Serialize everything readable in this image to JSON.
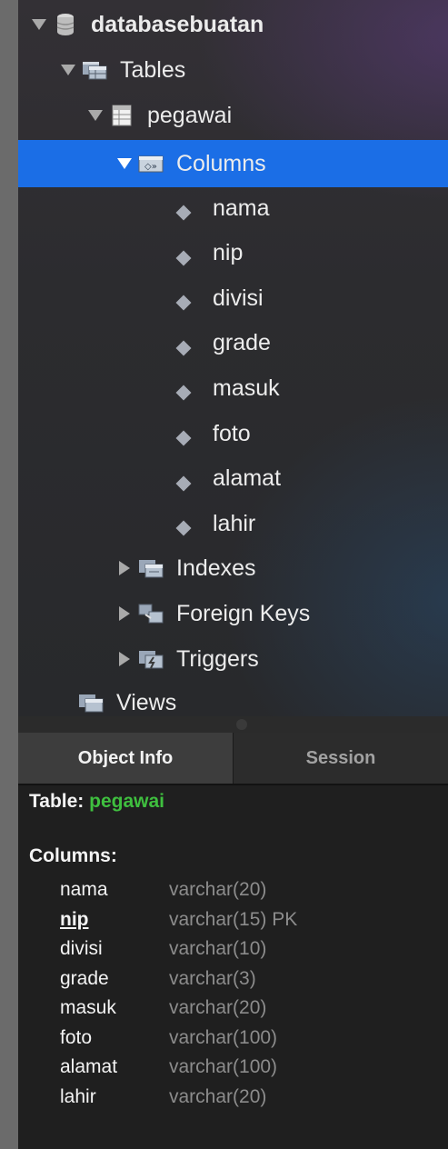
{
  "tree": {
    "database": "databasebuatan",
    "tables_label": "Tables",
    "table": "pegawai",
    "columns_label": "Columns",
    "columns": [
      "nama",
      "nip",
      "divisi",
      "grade",
      "masuk",
      "foto",
      "alamat",
      "lahir"
    ],
    "indexes_label": "Indexes",
    "foreign_keys_label": "Foreign Keys",
    "triggers_label": "Triggers",
    "views_label": "Views"
  },
  "tabs": {
    "object_info": "Object Info",
    "session": "Session"
  },
  "info": {
    "table_prefix": "Table:",
    "table_name": "pegawai",
    "columns_heading": "Columns:",
    "columns": [
      {
        "name": "nama",
        "type": "varchar(20)"
      },
      {
        "name": "nip",
        "type": "varchar(15) PK"
      },
      {
        "name": "divisi",
        "type": "varchar(10)"
      },
      {
        "name": "grade",
        "type": "varchar(3)"
      },
      {
        "name": "masuk",
        "type": "varchar(20)"
      },
      {
        "name": "foto",
        "type": "varchar(100)"
      },
      {
        "name": "alamat",
        "type": "varchar(100)"
      },
      {
        "name": "lahir",
        "type": "varchar(20)"
      }
    ]
  },
  "colors": {
    "selection": "#1b6ee6",
    "table_name": "#3fbf3f"
  }
}
